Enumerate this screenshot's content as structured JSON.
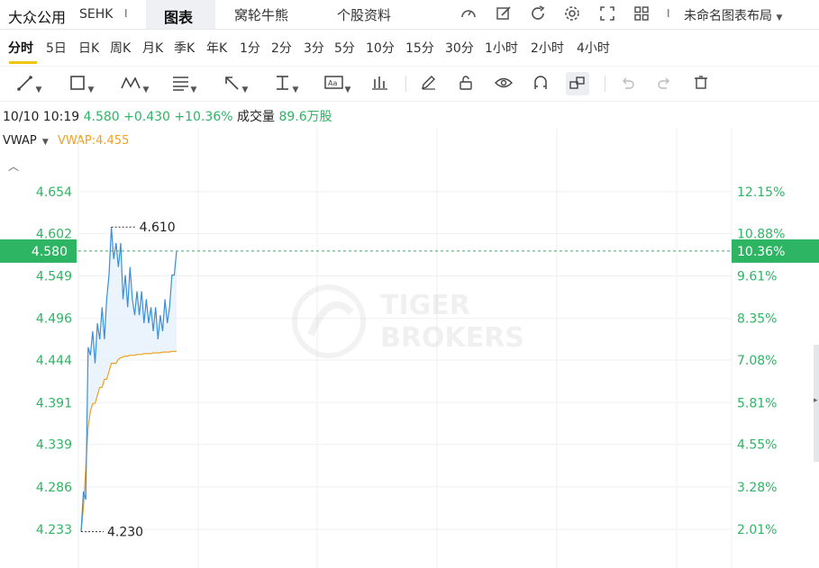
{
  "header": {
    "stock_name": "大众公用",
    "exchange": "SEHK",
    "separator": "I",
    "tabs": [
      "图表",
      "窝轮牛熊",
      "个股资料"
    ],
    "layout_name": "未命名图表布局"
  },
  "periods": [
    "分时",
    "5日",
    "日K",
    "周K",
    "月K",
    "季K",
    "年K",
    "1分",
    "2分",
    "3分",
    "5分",
    "10分",
    "15分",
    "30分",
    "1小时",
    "2小时",
    "4小时"
  ],
  "active_period": "分时",
  "toolbar_icons": [
    "line-tool-icon",
    "rectangle-tool-icon",
    "pattern-tool-icon",
    "fib-tool-icon",
    "arrow-tool-icon",
    "text-tool-icon",
    "annotation-tool-icon",
    "indicator-tool-icon",
    "pencil-icon",
    "lock-icon",
    "eye-icon",
    "magnet-icon",
    "link-icon",
    "undo-icon",
    "redo-icon",
    "delete-icon"
  ],
  "quote": {
    "datetime": "10/10 10:19",
    "price": "4.580",
    "change": "+0.430",
    "change_pct": "+10.36%",
    "volume_label": "成交量",
    "volume": "89.6万股"
  },
  "indicator": {
    "name": "VWAP",
    "value_text": "VWAP:4.455"
  },
  "watermark": {
    "line1": "TIGER",
    "line2": "BROKERS"
  },
  "colors": {
    "up": "#2db563",
    "price_line": "#3a8fd8",
    "vwap_line": "#f0a020",
    "accent": "#f0c414"
  },
  "chart_data": {
    "type": "line",
    "y_ticks": [
      "4.654",
      "4.602",
      "4.549",
      "4.496",
      "4.444",
      "4.391",
      "4.339",
      "4.286",
      "4.233"
    ],
    "pct_ticks": [
      "12.15%",
      "10.88%",
      "9.61%",
      "8.35%",
      "7.08%",
      "5.81%",
      "4.55%",
      "3.28%",
      "2.01%"
    ],
    "current_price": "4.580",
    "current_pct": "10.36%",
    "high_label": "4.610",
    "low_label": "4.230",
    "ylim": [
      4.206,
      4.681
    ],
    "series": [
      {
        "name": "price",
        "values": [
          4.23,
          4.28,
          4.27,
          4.46,
          4.45,
          4.48,
          4.44,
          4.49,
          4.47,
          4.51,
          4.47,
          4.52,
          4.55,
          4.61,
          4.57,
          4.59,
          4.56,
          4.59,
          4.52,
          4.55,
          4.51,
          4.56,
          4.52,
          4.5,
          4.53,
          4.5,
          4.53,
          4.49,
          4.52,
          4.49,
          4.51,
          4.48,
          4.51,
          4.47,
          4.5,
          4.48,
          4.52,
          4.49,
          4.51,
          4.55,
          4.55,
          4.58
        ]
      },
      {
        "name": "VWAP",
        "values": [
          4.23,
          4.26,
          4.31,
          4.36,
          4.38,
          4.39,
          4.39,
          4.4,
          4.41,
          4.41,
          4.42,
          4.42,
          4.43,
          4.44,
          4.44,
          4.44,
          4.445,
          4.447,
          4.448,
          4.449,
          4.449,
          4.45,
          4.45,
          4.45,
          4.451,
          4.451,
          4.451,
          4.452,
          4.452,
          4.452,
          4.452,
          4.453,
          4.453,
          4.453,
          4.453,
          4.454,
          4.454,
          4.454,
          4.454,
          4.455,
          4.455,
          4.455
        ]
      }
    ]
  }
}
